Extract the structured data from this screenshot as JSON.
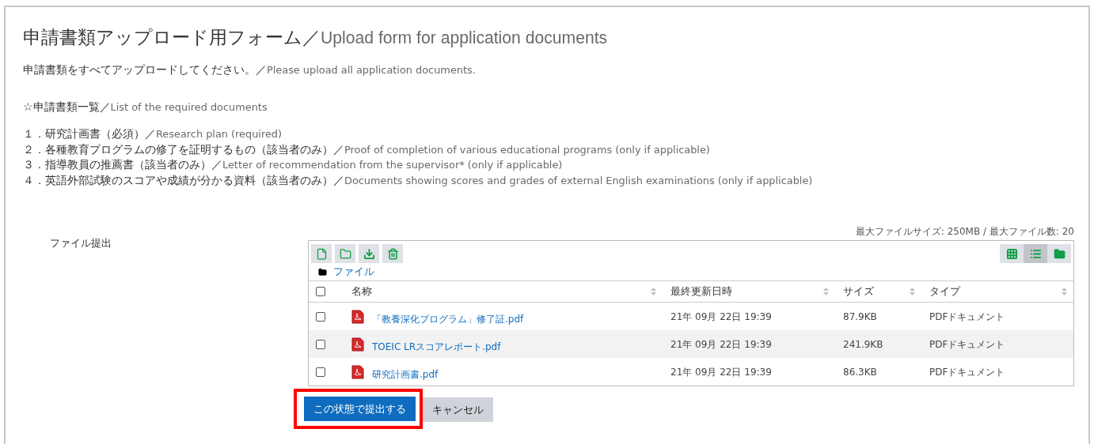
{
  "title": {
    "ja": "申請書類アップロード用フォーム／",
    "en": "Upload form for application documents"
  },
  "intro": {
    "ja": "申請書類をすべてアップロードしてください。／",
    "en": "Please upload all application documents."
  },
  "list_heading": {
    "ja": "☆申請書類一覧／",
    "en": "List of the required documents"
  },
  "documents": [
    {
      "ja": "１．研究計画書（必須）／",
      "en": "Research plan (required)"
    },
    {
      "ja": "２．各種教育プログラムの修了を証明するもの（該当者のみ）／",
      "en": "Proof of completion of various educational programs (only if applicable)"
    },
    {
      "ja": "３．指導教員の推薦書（該当者のみ）／",
      "en": "Letter of recommendation from the supervisor* (only if applicable)"
    },
    {
      "ja": "４．英語外部試験のスコアや成績が分かる資料（該当者のみ）／",
      "en": "Documents showing scores and grades of external English examinations (only if applicable)"
    }
  ],
  "field_label": "ファイル提出",
  "limits": "最大ファイルサイズ: 250MB / 最大ファイル数: 20",
  "toolbar": [
    {
      "kind": "add-file"
    },
    {
      "kind": "new-folder"
    },
    {
      "kind": "download"
    },
    {
      "kind": "delete"
    }
  ],
  "views": [
    {
      "kind": "grid",
      "selected": false
    },
    {
      "kind": "list",
      "selected": true
    },
    {
      "kind": "tree",
      "selected": false
    }
  ],
  "breadcrumb": "ファイル",
  "columns": [
    "名称",
    "最終更新日時",
    "サイズ",
    "タイプ"
  ],
  "header_checked": false,
  "rows": [
    {
      "checked": false,
      "name": "「教養深化プログラム」修了証.pdf",
      "modified": "21年 09月 22日 19:39",
      "size": "87.9KB",
      "type": "PDFドキュメント"
    },
    {
      "checked": false,
      "name": "TOEIC LRスコアレポート.pdf",
      "modified": "21年 09月 22日 19:39",
      "size": "241.9KB",
      "type": "PDFドキュメント"
    },
    {
      "checked": false,
      "name": "研究計画書.pdf",
      "modified": "21年 09月 22日 19:39",
      "size": "86.3KB",
      "type": "PDFドキュメント"
    }
  ],
  "buttons": [
    {
      "kind": "primary",
      "label": "この状態で提出する",
      "highlighted": true
    },
    {
      "kind": "secondary",
      "label": "キャンセル",
      "highlighted": false
    }
  ]
}
